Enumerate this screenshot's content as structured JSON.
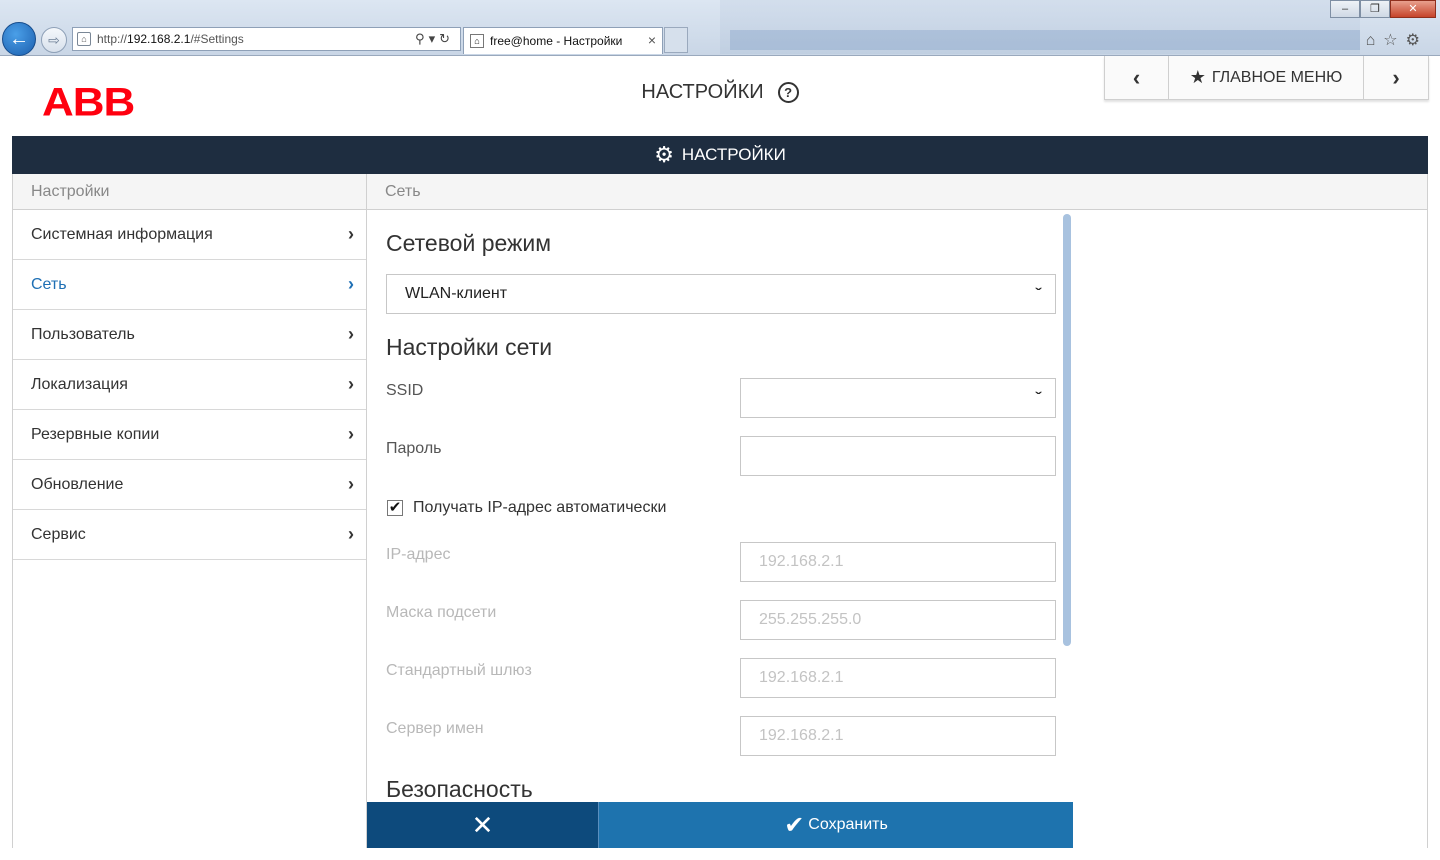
{
  "browser": {
    "url_prefix": "http://",
    "url_host": "192.168.2.1",
    "url_path": "/#Settings",
    "tab_title": "free@home - Настройки",
    "tab_close": "×"
  },
  "header": {
    "logo": "ABB",
    "title": "НАСТРОЙКИ",
    "help": "?",
    "nav_back": "‹",
    "main_menu": "ГЛАВНОЕ МЕНЮ",
    "nav_forward": "›"
  },
  "bar": {
    "title": "НАСТРОЙКИ"
  },
  "sidebar": {
    "heading": "Настройки",
    "items": [
      {
        "label": "Системная информация"
      },
      {
        "label": "Сеть"
      },
      {
        "label": "Пользователь"
      },
      {
        "label": "Локализация"
      },
      {
        "label": "Резервные копии"
      },
      {
        "label": "Обновление"
      },
      {
        "label": "Сервис"
      }
    ]
  },
  "content": {
    "heading": "Сеть",
    "network_mode_title": "Сетевой режим",
    "network_mode_value": "WLAN-клиент",
    "network_settings_title": "Настройки сети",
    "ssid_label": "SSID",
    "ssid_value": "",
    "password_label": "Пароль",
    "password_value": "",
    "auto_ip_label": "Получать IP-адрес автоматически",
    "auto_ip_checked": true,
    "ip_label": "IP-адрес",
    "ip_value": "192.168.2.1",
    "mask_label": "Маска подсети",
    "mask_value": "255.255.255.0",
    "gateway_label": "Стандартный шлюз",
    "gateway_value": "192.168.2.1",
    "dns_label": "Сервер имен",
    "dns_value": "192.168.2.1",
    "security_title": "Безопасность"
  },
  "footer": {
    "cancel_icon": "✕",
    "save_label": "Сохранить"
  },
  "colors": {
    "abb_red": "#ff000f",
    "bar_dark": "#1e2d40",
    "active_blue": "#1e6fb4",
    "cancel_blue": "#0d4a7c",
    "save_blue": "#1e73ae"
  }
}
